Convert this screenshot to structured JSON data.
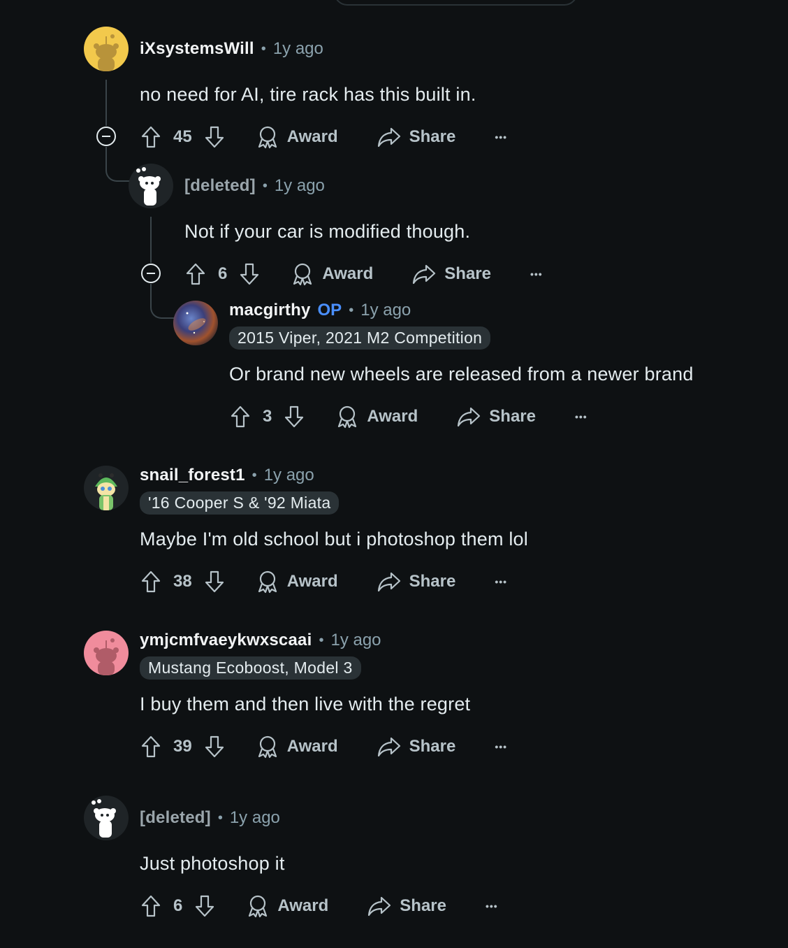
{
  "comments": [
    {
      "author": "iXsystemsWill",
      "time": "1y ago",
      "text": "no need for AI, tire rack has this built in.",
      "votes": "45",
      "avatar_color": "#f2c94c"
    },
    {
      "author": "[deleted]",
      "time": "1y ago",
      "text": "Not if your car is modified though.",
      "votes": "6"
    },
    {
      "author": "macgirthy",
      "op_label": "OP",
      "time": "1y ago",
      "flair": "2015 Viper, 2021 M2 Competition",
      "text": "Or brand new wheels are released from a newer brand",
      "votes": "3"
    },
    {
      "author": "snail_forest1",
      "time": "1y ago",
      "flair": "'16 Cooper S & '92 Miata",
      "text": "Maybe I'm old school but i photoshop them lol",
      "votes": "38"
    },
    {
      "author": "ymjcmfvaeykwxscaai",
      "time": "1y ago",
      "flair": "Mustang Ecoboost, Model 3",
      "text": "I buy them and then live with the regret",
      "votes": "39",
      "avatar_color": "#f08c9c"
    },
    {
      "author": "[deleted]",
      "time": "1y ago",
      "text": "Just photoshop it",
      "votes": "6"
    }
  ],
  "labels": {
    "separator": "•",
    "award": "Award",
    "share": "Share",
    "more": "•••"
  },
  "colors": {
    "background": "#0e1113",
    "op_badge": "#4a8fff",
    "flair_bg": "#2a3236"
  }
}
